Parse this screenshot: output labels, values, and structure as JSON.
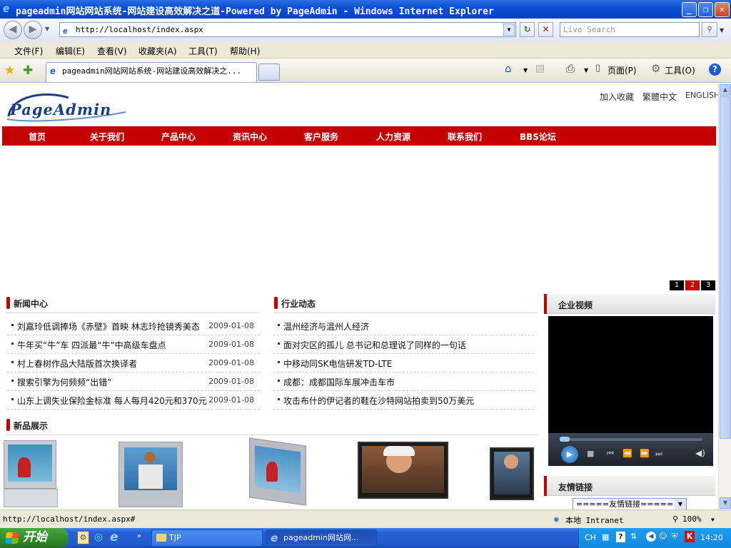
{
  "window": {
    "title": "pageadmin网站网站系统-网站建设高效解决之道-Powered by PageAdmin - Windows Internet Explorer",
    "minimize": "_",
    "restore": "❐",
    "close": "✕"
  },
  "address_bar": {
    "url": "http://localhost/index.aspx",
    "search_placeholder": "Live Search",
    "back": "◀",
    "forward": "▶",
    "refresh": "↻",
    "stop": "✕",
    "search_go": "🔍"
  },
  "menu": [
    "文件(F)",
    "编辑(E)",
    "查看(V)",
    "收藏夹(A)",
    "工具(T)",
    "帮助(H)"
  ],
  "tabs": {
    "active_label": "pageadmin网站网站系统-网站建设高效解决之..."
  },
  "command_bar": {
    "page": "页面(P)",
    "tools": "工具(O)"
  },
  "site": {
    "logo_text": "PageAdmin",
    "top_links": [
      "加入收藏",
      "繁體中文",
      "ENGLISH"
    ],
    "nav": [
      "首页",
      "关于我们",
      "产品中心",
      "资讯中心",
      "客户服务",
      "人力资源",
      "联系我们",
      "BBS论坛"
    ],
    "banner_pages": [
      "1",
      "2",
      "3"
    ],
    "banner_active": "2",
    "news": {
      "title": "新闻中心",
      "items": [
        {
          "text": "刘嘉玲低调捧场《赤壁》首映 林志玲抢镜秀美态",
          "date": "2009-01-08"
        },
        {
          "text": "牛年买“牛”车 四派最“牛”中高级车盘点",
          "date": "2009-01-08"
        },
        {
          "text": "村上春树作品大陆版首次换译者",
          "date": "2009-01-08"
        },
        {
          "text": "搜索引擎为何频频“出错”",
          "date": "2009-01-08"
        },
        {
          "text": "山东上调失业保险金标准 每人每月420元和370元",
          "date": "2009-01-08"
        }
      ]
    },
    "industry": {
      "title": "行业动态",
      "items": [
        "温州经济与温州人经济",
        "面对灾区的孤儿 总书记和总理说了同样的一句话",
        "中移动同SK电信研发TD-LTE",
        "成都：成都国际车展冲击车市",
        "攻击布什的伊记者的鞋在沙特网站拍卖到50万美元"
      ]
    },
    "products_title": "新品展示",
    "video_title": "企业视频",
    "links_title": "友情链接",
    "links_select": "=====友情链接====="
  },
  "status": {
    "url": "http://localhost/index.aspx#",
    "zone": "本地 Intranet",
    "zoom": "100%"
  },
  "taskbar": {
    "start": "开始",
    "items": [
      "TJP",
      "pageadmin网站网..."
    ],
    "lang": "CH",
    "time": "14:20"
  }
}
